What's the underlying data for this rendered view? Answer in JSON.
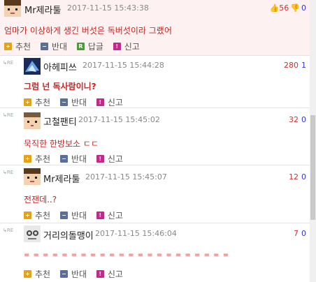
{
  "comments": [
    {
      "nick": "Mr제라툴",
      "date": "2017-11-15 15:43:38",
      "up": "56",
      "down": "0",
      "body": "엄마가 이상하게 생긴 버섯은 독버섯이라 그랬어",
      "actions": [
        "추천",
        "반대",
        "답글",
        "신고"
      ]
    },
    {
      "re": "RE",
      "nick": "아헤피쓰",
      "date": "2017-11-15 15:44:28",
      "up": "280",
      "down": "1",
      "body": "그럼 넌 독사람이니?",
      "actions": [
        "추천",
        "반대",
        "신고"
      ]
    },
    {
      "re": "RE",
      "nick": "고철팬티",
      "date": "2017-11-15 15:45:02",
      "up": "32",
      "down": "0",
      "body": "묵직한 한방보소 ㄷㄷ",
      "actions": [
        "추천",
        "반대",
        "신고"
      ]
    },
    {
      "re": "RE",
      "nick": "Mr제라툴",
      "date": "2017-11-15 15:45:07",
      "up": "12",
      "down": "0",
      "body": "전잰데..?",
      "actions": [
        "추천",
        "반대",
        "신고"
      ]
    },
    {
      "re": "RE",
      "nick": "거리의돌맹이",
      "date": "2017-11-15 15:46:04",
      "up": "7",
      "down": "0",
      "body": "= = = = = = = = = = = = = = = = = = = = = =",
      "actions": [
        "추천",
        "반대",
        "신고"
      ]
    }
  ],
  "colors": {
    "accent_red": "#cc2a2a",
    "up": "#cc3333",
    "down": "#3333cc"
  },
  "icons": {
    "up": "thumbs-up-icon",
    "down": "thumbs-down-icon",
    "recommend": "plus-icon",
    "oppose": "minus-icon",
    "reply": "reply-icon",
    "report": "report-icon"
  }
}
